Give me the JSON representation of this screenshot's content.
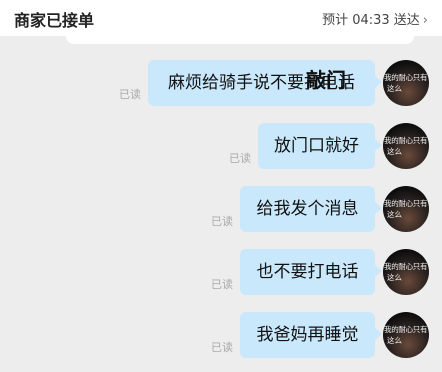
{
  "header": {
    "title": "商家已接单",
    "eta": "预计 04:33 送达",
    "chevron": "›"
  },
  "avatar": {
    "line1": "我的耐心只有",
    "line2": "这么"
  },
  "messages": [
    {
      "text": "麻烦给骑手说不要打电话",
      "read": "已读",
      "overlay": "敲门"
    },
    {
      "text": "放门口就好",
      "read": "已读"
    },
    {
      "text": "给我发个消息",
      "read": "已读"
    },
    {
      "text": "也不要打电话",
      "read": "已读"
    },
    {
      "text": "我爸妈再睡觉",
      "read": "已读"
    }
  ]
}
